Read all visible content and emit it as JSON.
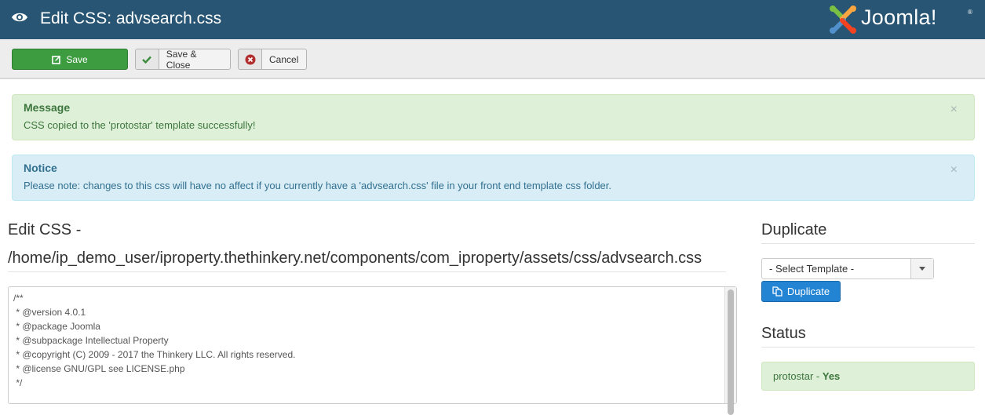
{
  "header": {
    "title": "Edit CSS: advsearch.css",
    "icon": "eye-icon",
    "logo_text": "Joomla!",
    "logo_reg": "®",
    "bg_color": "#285573"
  },
  "toolbar": {
    "save_label": "Save",
    "save_close_label": "Save & Close",
    "cancel_label": "Cancel"
  },
  "alerts": {
    "success": {
      "title": "Message",
      "text": "CSS copied to the 'protostar' template successfully!",
      "close": "×"
    },
    "notice": {
      "title": "Notice",
      "text": "Please note: changes to this css will have no affect if you currently have a 'advsearch.css' file in your front end template css folder.",
      "close": "×"
    }
  },
  "main": {
    "heading": "Edit CSS -",
    "path": "/home/ip_demo_user/iproperty.thethinkery.net/components/com_iproperty/assets/css/advsearch.css",
    "editor_content": "/**\n * @version 4.0.1\n * @package Joomla\n * @subpackage Intellectual Property\n * @copyright (C) 2009 - 2017 the Thinkery LLC. All rights reserved.\n * @license GNU/GPL see LICENSE.php\n */"
  },
  "sidebar": {
    "duplicate_heading": "Duplicate",
    "select_value": "- Select Template -",
    "duplicate_button": "Duplicate",
    "status_heading": "Status",
    "status_template": "protostar - ",
    "status_value": "Yes"
  }
}
